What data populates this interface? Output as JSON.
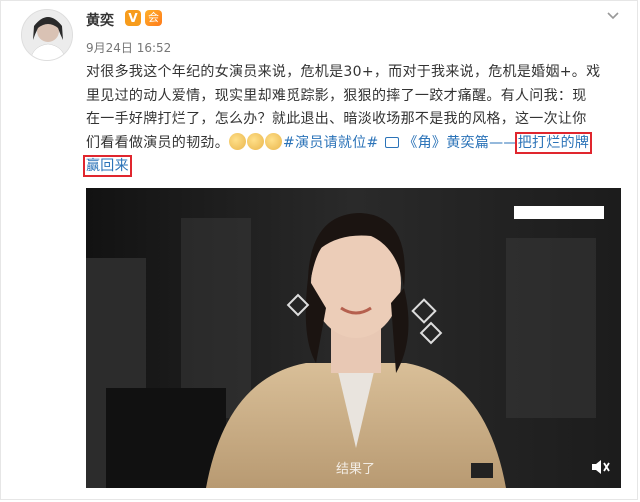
{
  "post": {
    "username": "黄奕",
    "verified_badge": "V",
    "member_badge": "会",
    "timestamp": "9月24日 16:52",
    "text_line1": "对很多我这个年纪的女演员来说，危机是30+，而对于我来说，危机是婚姻+。戏",
    "text_line2": "里见过的动人爱情，现实里却难觅踪影，狠狠的摔了一跤才痛醒。有人问我：现",
    "text_line3": "在一手好牌打烂了，怎么办？就此退出、暗淡收场那不是我的风格，这一次让你",
    "text_line4_prefix": "们看看做演员的韧劲。",
    "hashtag": "#演员请就位#",
    "link_text": "《角》黄奕篇——",
    "highlight_part1": "把打烂的牌",
    "highlight_part2": "赢回来",
    "video_subtitle": "结果了"
  },
  "icons": {
    "menu": "chevron-down-icon",
    "link": "link-icon",
    "mute": "volume-off-icon"
  },
  "colors": {
    "link": "#2b73b8",
    "highlight_border": "#e0262e",
    "vip": "#f79c1c"
  }
}
